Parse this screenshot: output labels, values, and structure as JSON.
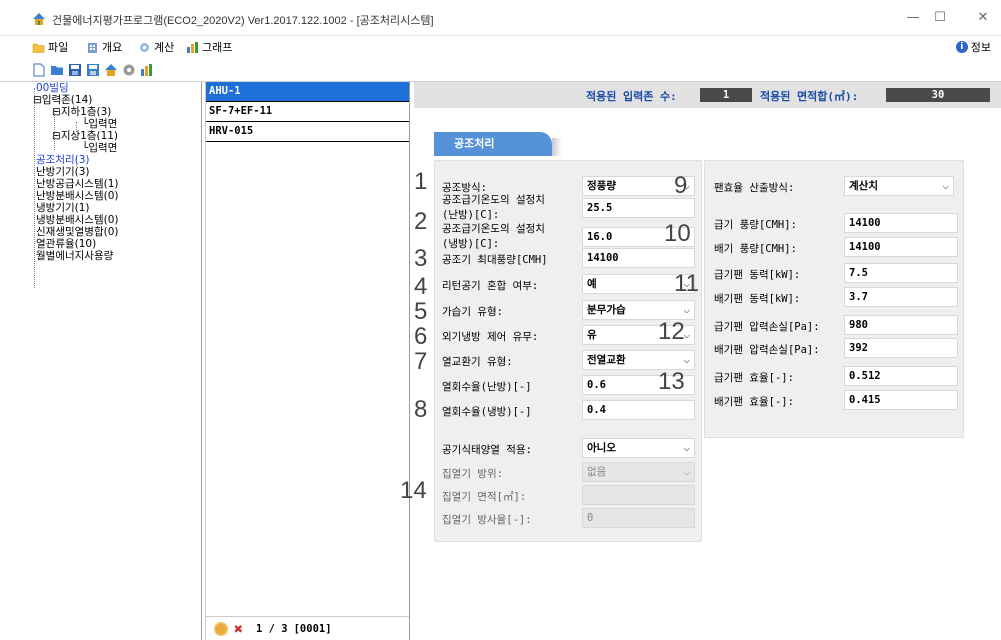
{
  "window": {
    "title": "건물에너지평가프로그램(ECO2_2020V2) Ver1.2017.122.1002 - [공조처리시스템]",
    "minimize": "—",
    "maximize": "☐",
    "close": "✕"
  },
  "menu": {
    "file": "파일",
    "overview": "개요",
    "calc": "계산",
    "graph": "그래프",
    "info": "정보"
  },
  "tree": [
    {
      "label": "00빌딩",
      "blue": true
    },
    {
      "label": "입력존(14)",
      "blue": false
    },
    {
      "label": "지하1층(3)",
      "blue": false
    },
    {
      "label": "입력면",
      "blue": false
    },
    {
      "label": "지상1층(11)",
      "blue": false
    },
    {
      "label": "입력면",
      "blue": false
    },
    {
      "label": "공조처리(3)",
      "blue": true
    },
    {
      "label": "난방기기(3)",
      "blue": false
    },
    {
      "label": "난방공급시스템(1)",
      "blue": false
    },
    {
      "label": "난방분배시스템(0)",
      "blue": false
    },
    {
      "label": "냉방기기(1)",
      "blue": false
    },
    {
      "label": "냉방분배시스템(0)",
      "blue": false
    },
    {
      "label": "신재생및열병합(0)",
      "blue": false
    },
    {
      "label": "열관류율(10)",
      "blue": false
    },
    {
      "label": "월별에너지사용량",
      "blue": false
    }
  ],
  "list": {
    "items": [
      "AHU-1",
      "SF-7+EF-11",
      "HRV-015"
    ],
    "page": "1 / 3",
    "code": "[0001]"
  },
  "topbar": {
    "zones_label": "적용된 입력존 수:",
    "zones_value": "1",
    "area_label": "적용된 면적합(㎡):",
    "area_value": "30"
  },
  "section_tab": "공조처리",
  "left_fields": [
    {
      "label": "공조방식:",
      "value": "정풍량",
      "select": true,
      "num": "1"
    },
    {
      "label": "공조급기온도의 설정치\n(난방)[C]:",
      "value": "25.5",
      "select": false,
      "num": "2"
    },
    {
      "label": "공조급기온도의 설정치\n(냉방)[C]:",
      "value": "16.0",
      "select": false,
      "num": ""
    },
    {
      "label": "공조기 최대풍량[CMH]",
      "value": "14100",
      "select": false,
      "num": "3"
    },
    {
      "label": "리턴공기 혼합 여부:",
      "value": "예",
      "select": true,
      "num": "4"
    },
    {
      "label": "가습기 유형:",
      "value": "분무가습",
      "select": true,
      "num": "5"
    },
    {
      "label": "외기냉방 제어 유무:",
      "value": "유",
      "select": true,
      "num": "6"
    },
    {
      "label": "열교환기 유형:",
      "value": "전열교환",
      "select": true,
      "num": "7"
    },
    {
      "label": "열회수율(난방)[-]",
      "value": "0.6",
      "select": false,
      "num": ""
    },
    {
      "label": "열회수율(냉방)[-]",
      "value": "0.4",
      "select": false,
      "num": "8"
    },
    {
      "label": "공기식태양열 적용:",
      "value": "아니오",
      "select": true,
      "num": ""
    },
    {
      "label": "집열기 방위:",
      "value": "없음",
      "select": true,
      "num": "",
      "disabled": true
    },
    {
      "label": "집열기 면적[㎡]:",
      "value": "",
      "select": false,
      "num": "14",
      "disabled": true
    },
    {
      "label": "집열기 방사율[-]:",
      "value": "0",
      "select": false,
      "num": "",
      "disabled": true
    }
  ],
  "right_fields": [
    {
      "label": "팬효율 산출방식:",
      "value": "계산치",
      "select": true,
      "num": "9"
    },
    {
      "label": "급기 풍량[CMH]:",
      "value": "14100",
      "select": false,
      "num": "10"
    },
    {
      "label": "배기 풍량[CMH]:",
      "value": "14100",
      "select": false,
      "num": ""
    },
    {
      "label": "급기팬 동력[kW]:",
      "value": "7.5",
      "select": false,
      "num": "11"
    },
    {
      "label": "배기팬 동력[kW]:",
      "value": "3.7",
      "select": false,
      "num": ""
    },
    {
      "label": "급기팬 압력손실[Pa]:",
      "value": "980",
      "select": false,
      "num": "12"
    },
    {
      "label": "배기팬 압력손실[Pa]:",
      "value": "392",
      "select": false,
      "num": ""
    },
    {
      "label": "급기팬 효율[-]:",
      "value": "0.512",
      "select": false,
      "num": "13"
    },
    {
      "label": "배기팬 효율[-]:",
      "value": "0.415",
      "select": false,
      "num": ""
    }
  ]
}
